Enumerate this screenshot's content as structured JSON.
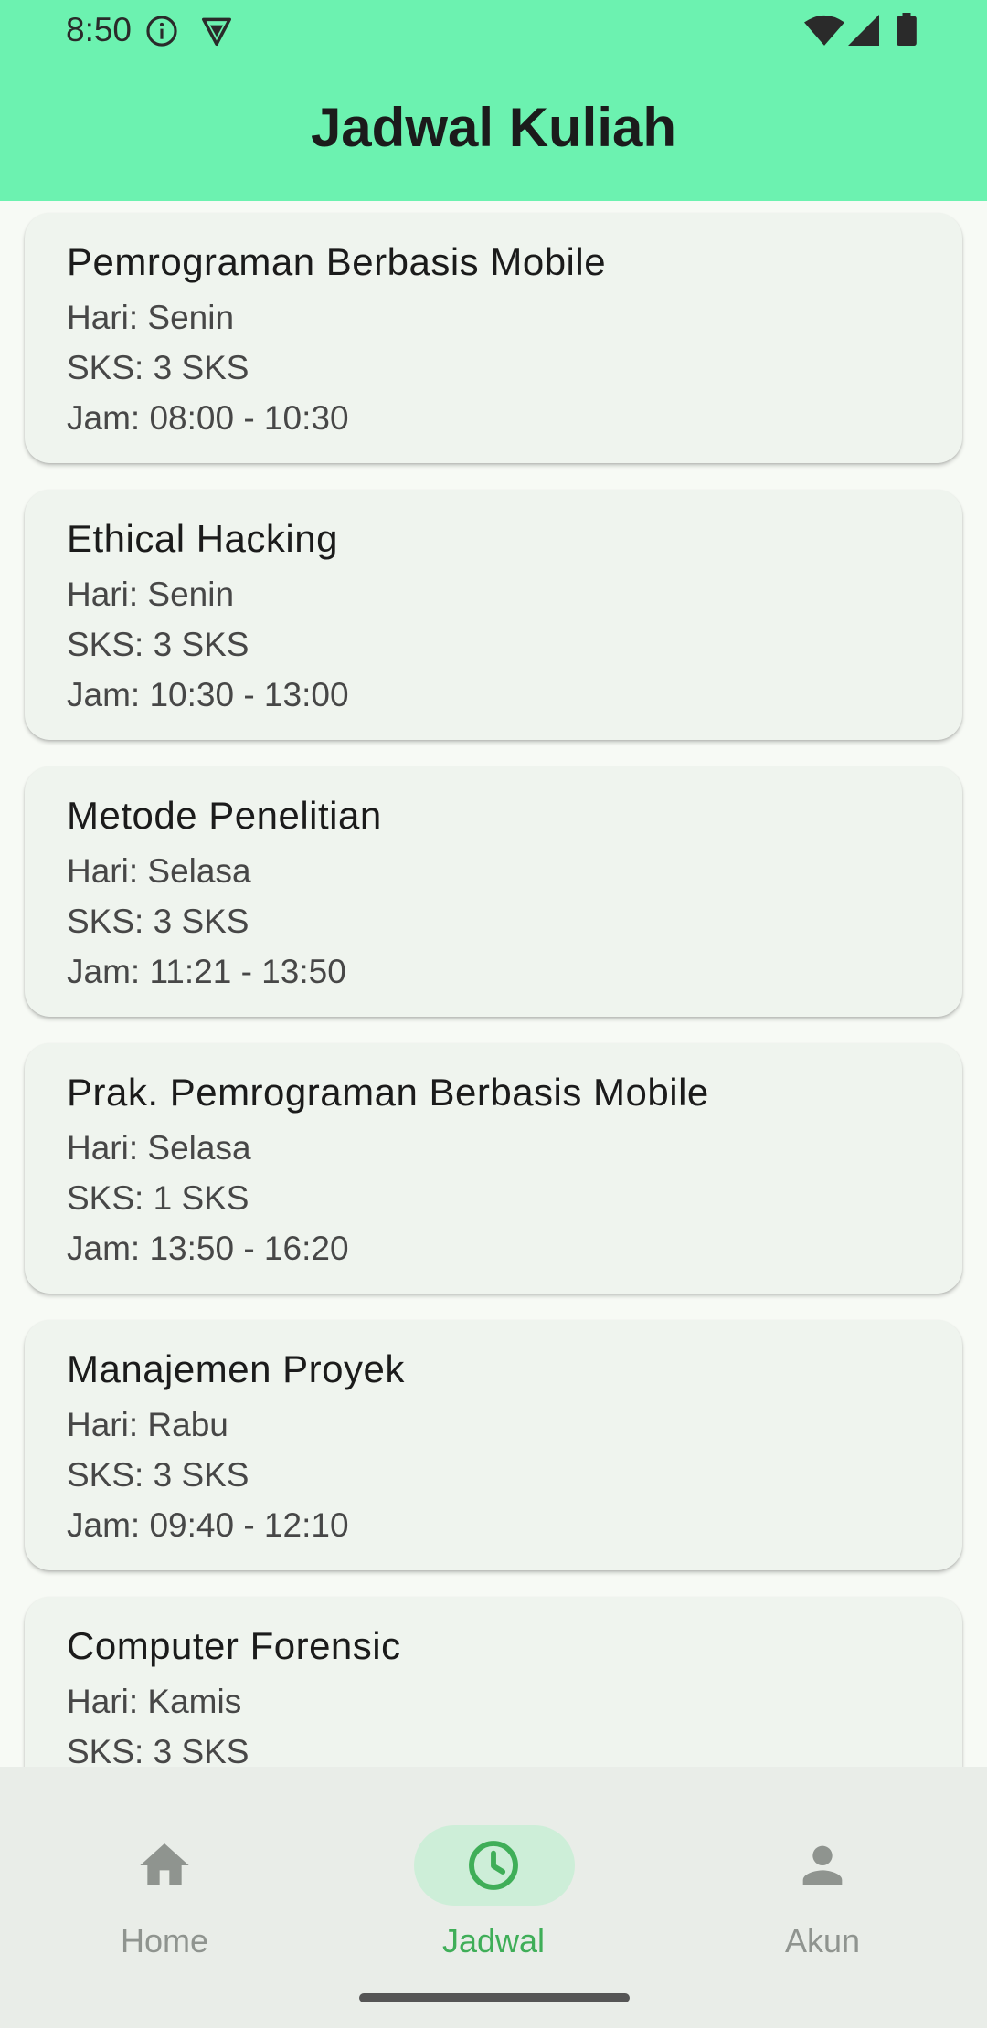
{
  "status_bar": {
    "time": "8:50",
    "icons": [
      "info-icon",
      "vpn-icon",
      "wifi-icon",
      "signal-icon",
      "battery-icon"
    ]
  },
  "header": {
    "title": "Jadwal Kuliah",
    "background_color": "#6cf2b0"
  },
  "courses": [
    {
      "name": "Pemrograman Berbasis Mobile",
      "day": "Hari: Senin",
      "credits": "SKS: 3 SKS",
      "time": "Jam: 08:00 - 10:30"
    },
    {
      "name": "Ethical Hacking",
      "day": "Hari: Senin",
      "credits": "SKS: 3 SKS",
      "time": "Jam: 10:30 - 13:00"
    },
    {
      "name": "Metode Penelitian",
      "day": "Hari: Selasa",
      "credits": "SKS: 3 SKS",
      "time": "Jam: 11:21 - 13:50"
    },
    {
      "name": "Prak. Pemrograman Berbasis Mobile",
      "day": "Hari: Selasa",
      "credits": "SKS: 1 SKS",
      "time": "Jam: 13:50 - 16:20"
    },
    {
      "name": "Manajemen Proyek",
      "day": "Hari: Rabu",
      "credits": "SKS: 3 SKS",
      "time": "Jam: 09:40 - 12:10"
    },
    {
      "name": "Computer Forensic",
      "day": "Hari: Kamis",
      "credits": "SKS: 3 SKS"
    }
  ],
  "bottom_nav": {
    "items": [
      {
        "label": "Home",
        "icon": "home-icon",
        "active": false
      },
      {
        "label": "Jadwal",
        "icon": "clock-icon",
        "active": true
      },
      {
        "label": "Akun",
        "icon": "person-icon",
        "active": false
      }
    ],
    "active_color": "#3fae58",
    "inactive_color": "#8f948f"
  }
}
